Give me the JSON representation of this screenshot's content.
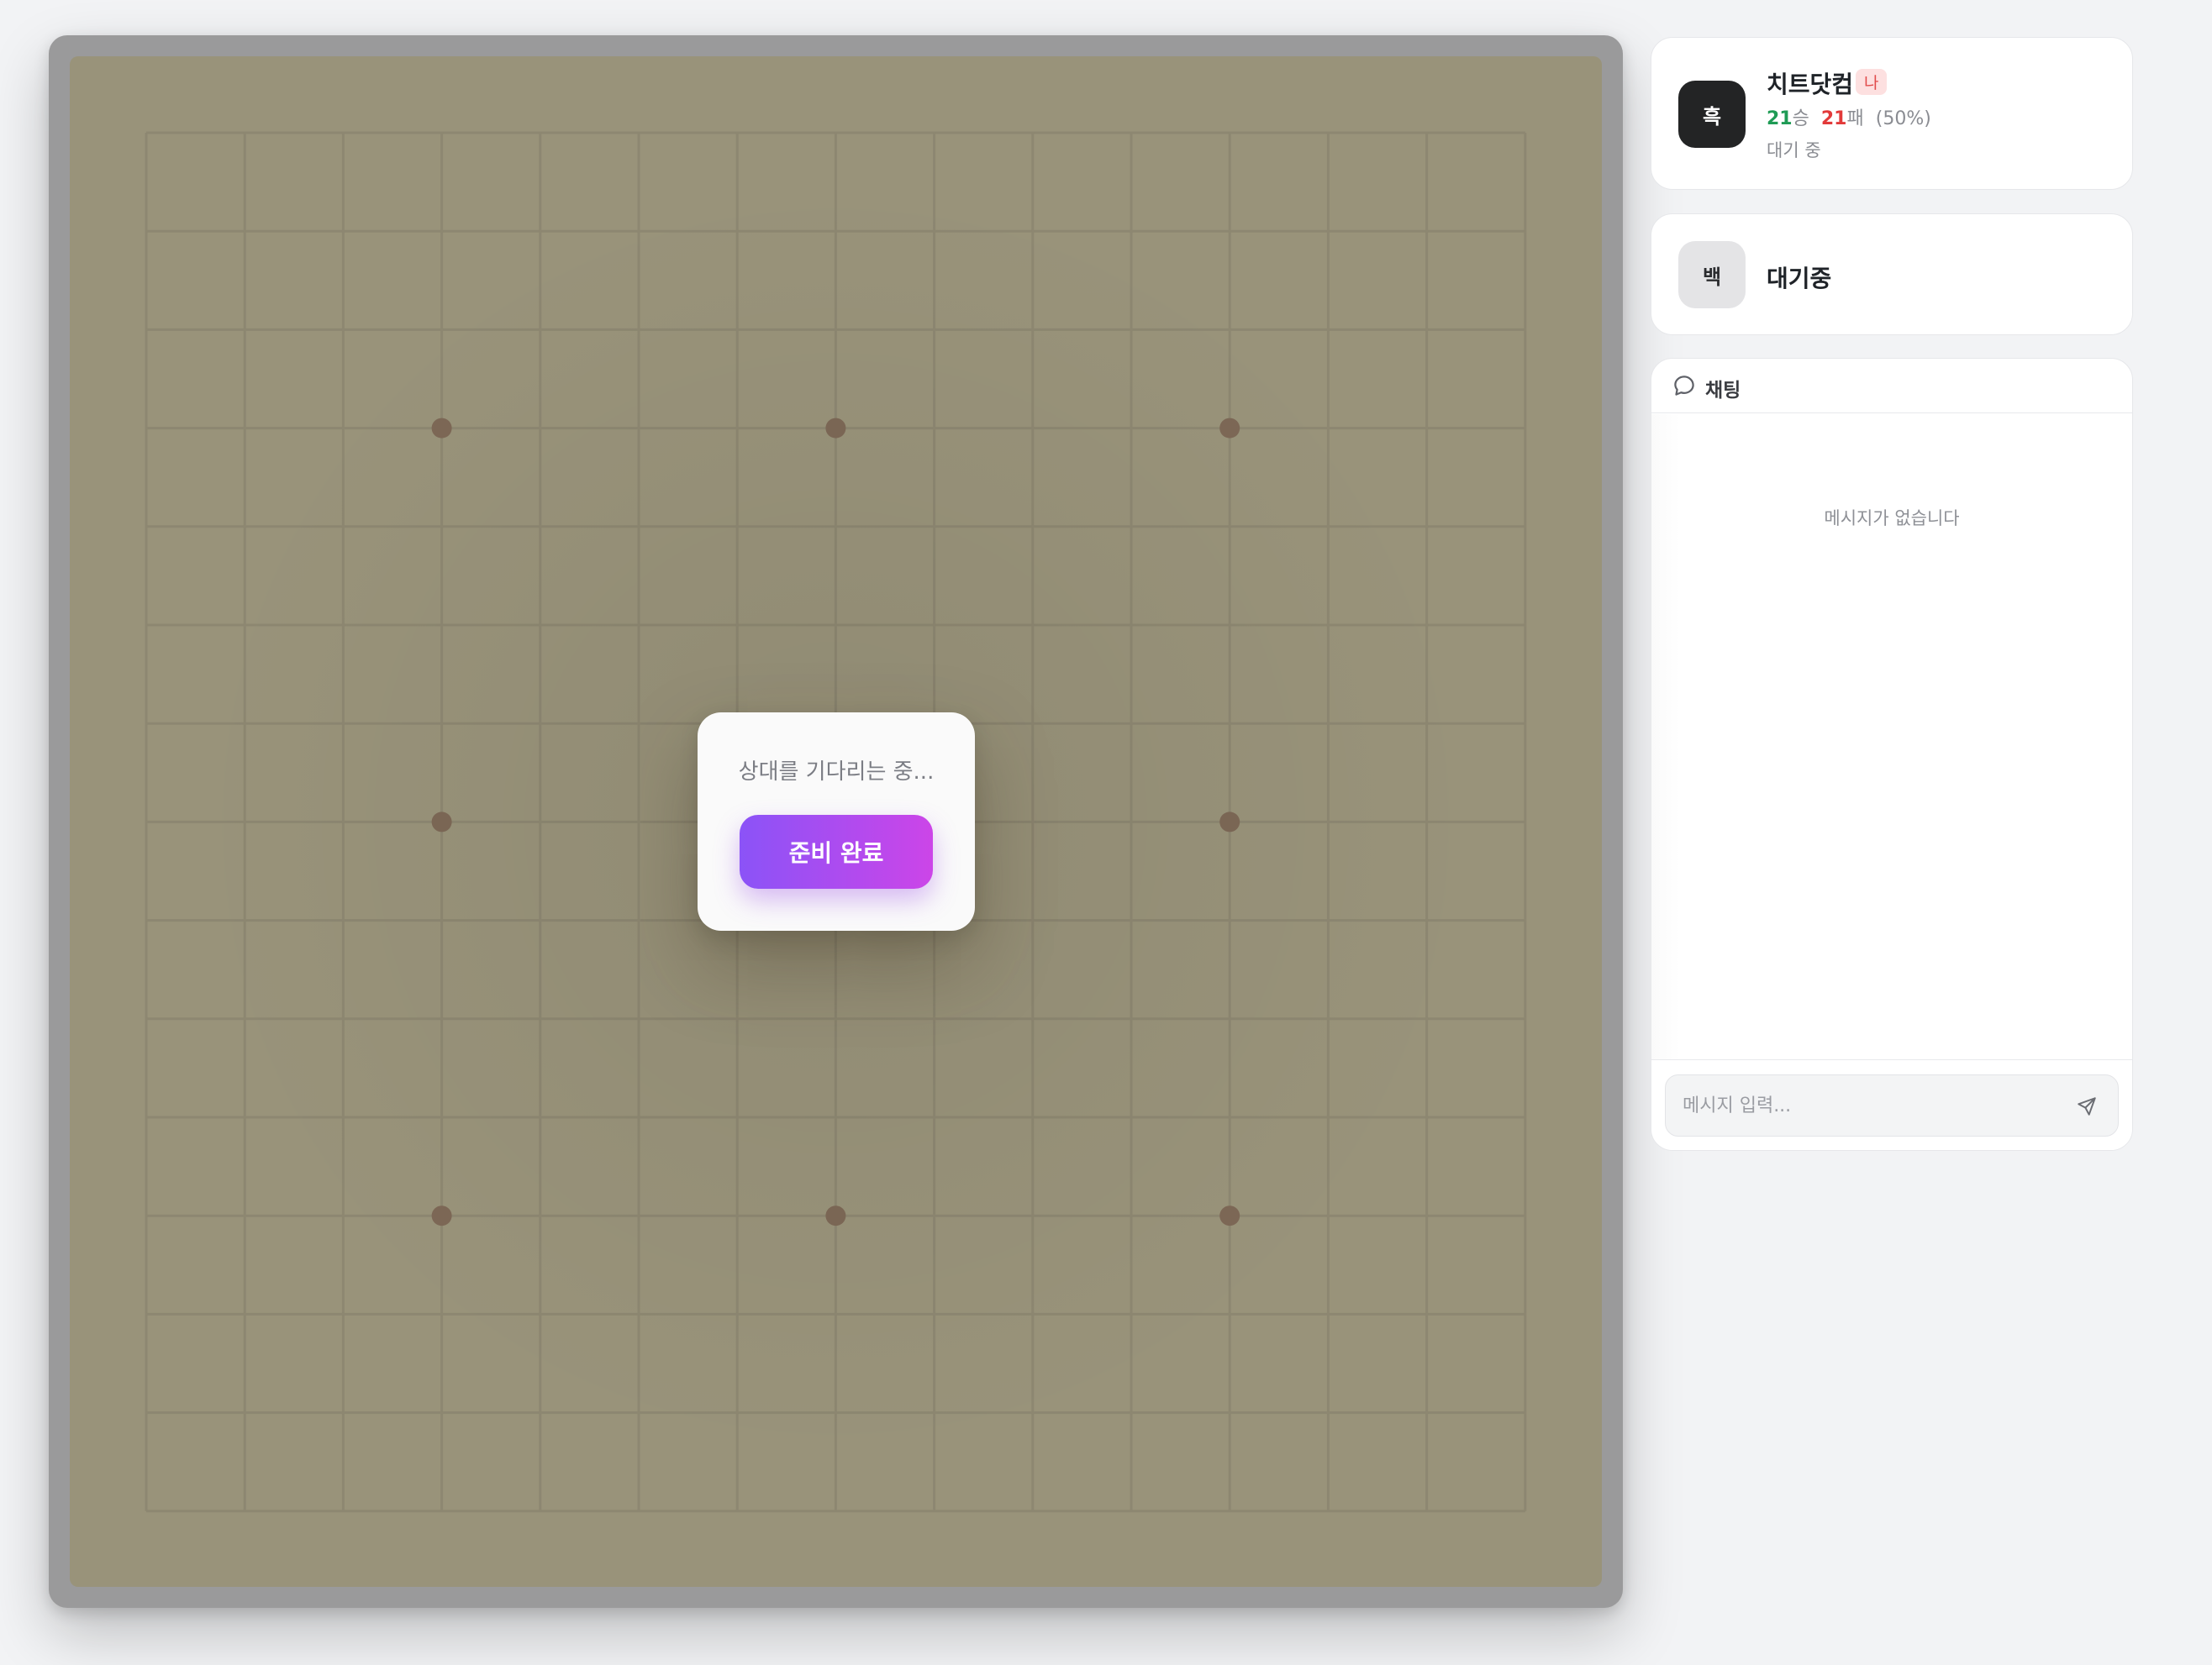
{
  "board": {
    "size": 15,
    "star_points": [
      [
        3,
        3
      ],
      [
        3,
        7
      ],
      [
        3,
        11
      ],
      [
        7,
        3
      ],
      [
        7,
        11
      ],
      [
        11,
        3
      ],
      [
        11,
        7
      ],
      [
        11,
        11
      ]
    ]
  },
  "ready_modal": {
    "text": "상대를 기다리는 중...",
    "button_label": "준비 완료"
  },
  "player_black": {
    "avatar_label": "흑",
    "name": "치트닷컴",
    "me_badge": "나",
    "wins": "21",
    "wins_unit": "승",
    "losses": "21",
    "losses_unit": "패",
    "win_rate": "(50%)",
    "status": "대기 중"
  },
  "player_white": {
    "avatar_label": "백",
    "name": "대기중"
  },
  "chat": {
    "title": "채팅",
    "empty_text": "메시지가 없습니다",
    "input_placeholder": "메시지 입력..."
  },
  "colors": {
    "accent_gradient_start": "#8b53f7",
    "accent_gradient_end": "#cc45e8",
    "wins": "#1f9b55",
    "losses": "#e23a3a"
  }
}
